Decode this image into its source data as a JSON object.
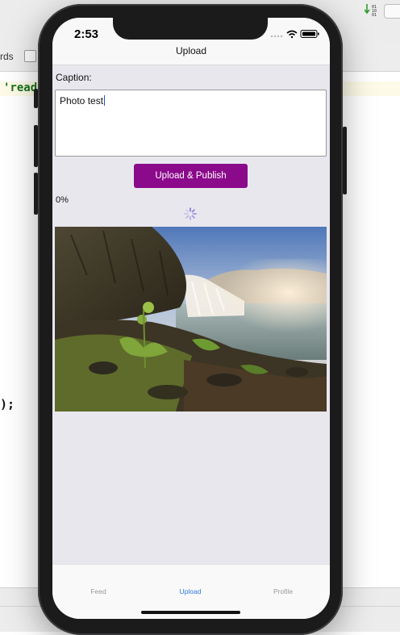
{
  "editor": {
    "toolbar_label": "rds",
    "code_line": "'read",
    "code_close": ");"
  },
  "status_bar": {
    "time": "2:53"
  },
  "nav": {
    "title": "Upload"
  },
  "form": {
    "caption_label": "Caption:",
    "caption_value": "Photo test",
    "publish_button": "Upload & Publish",
    "progress": "0%",
    "progress_fraction": 0
  },
  "tabs": [
    {
      "label": "Feed",
      "active": false
    },
    {
      "label": "Upload",
      "active": true
    },
    {
      "label": "Profile",
      "active": false
    }
  ],
  "colors": {
    "accent": "#8b0a8b",
    "tab_active": "#2f7ae5",
    "screen_bg": "#e8e7ee"
  },
  "icons": [
    "binary-icon",
    "signal-icon",
    "wifi-icon",
    "battery-icon",
    "spinner-icon"
  ]
}
